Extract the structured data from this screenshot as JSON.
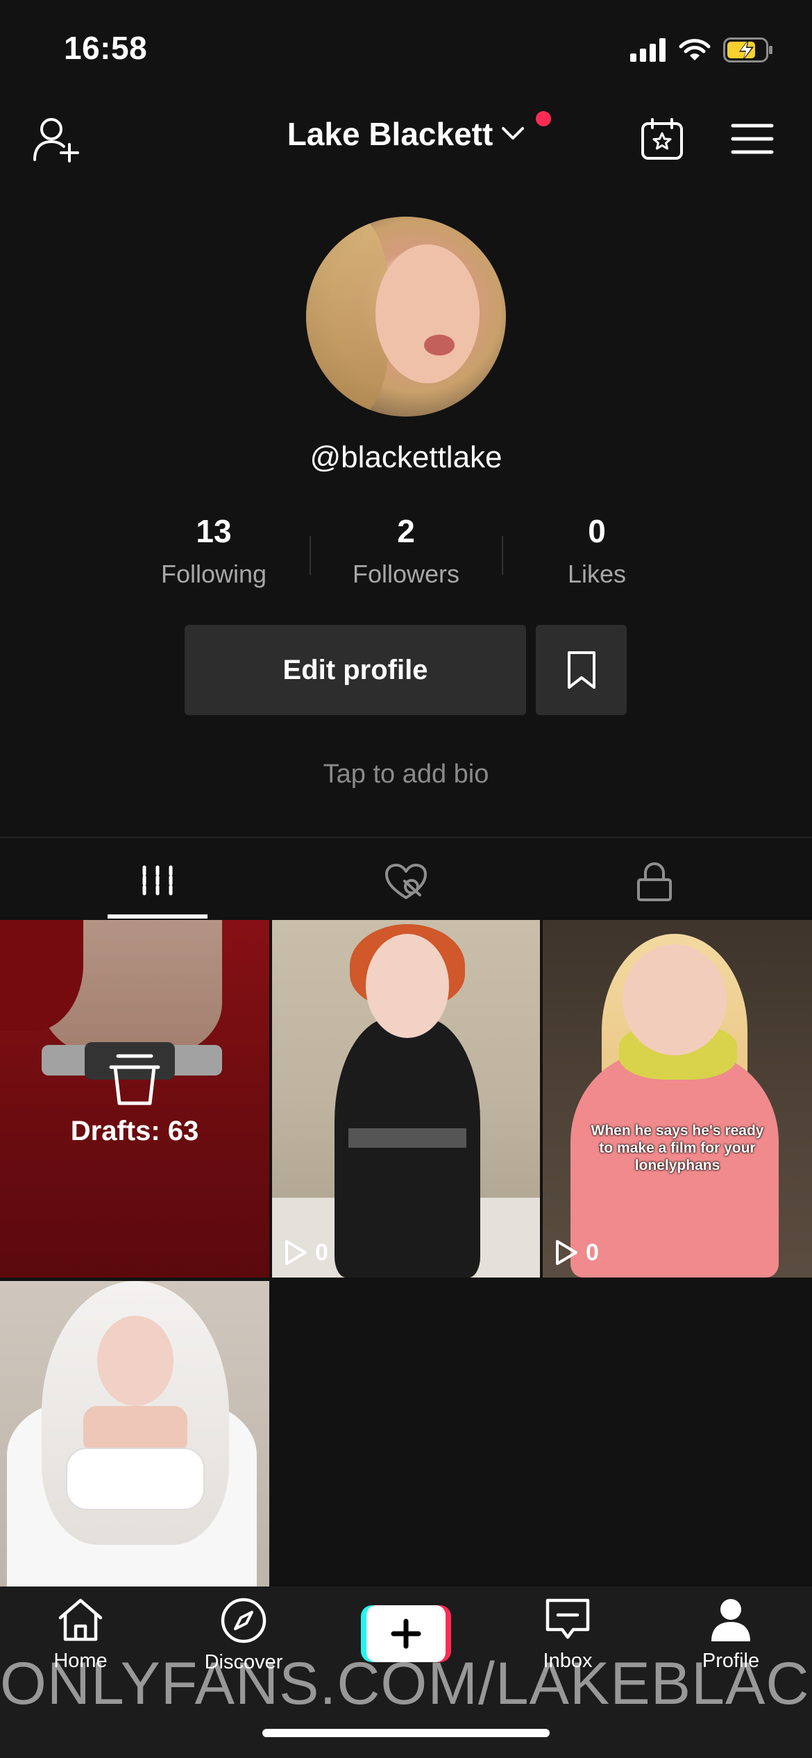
{
  "status_bar": {
    "time": "16:58"
  },
  "header": {
    "username": "Lake Blackett"
  },
  "profile": {
    "handle": "@blackettlake",
    "stats": [
      {
        "value": "13",
        "label": "Following"
      },
      {
        "value": "2",
        "label": "Followers"
      },
      {
        "value": "0",
        "label": "Likes"
      }
    ],
    "edit_label": "Edit profile",
    "bio_placeholder": "Tap to add bio"
  },
  "grid": {
    "drafts_label": "Drafts: 63",
    "videos": [
      {
        "plays": "0"
      },
      {
        "plays": "0",
        "caption": "When he says he's ready to make a film for your lonelyphans"
      }
    ]
  },
  "nav": {
    "home": "Home",
    "discover": "Discover",
    "inbox": "Inbox",
    "profile": "Profile"
  },
  "watermark": "ONLYFANS.COM/LAKEBLACKETT",
  "colors": {
    "accent": "#fe2c55",
    "cyan": "#25f4ee",
    "background": "#121212",
    "button": "#2d2d2d"
  }
}
